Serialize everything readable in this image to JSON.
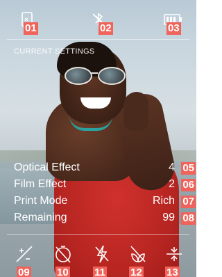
{
  "top_icons": [
    {
      "name": "phone-icon",
      "tag": "01"
    },
    {
      "name": "bluetooth-off-icon",
      "tag": "02"
    },
    {
      "name": "battery-icon",
      "tag": "03"
    }
  ],
  "settings": {
    "title": "CURRENT SETTINGS",
    "rows": [
      {
        "label": "Optical Effect",
        "value": "4",
        "tag": "05"
      },
      {
        "label": "Film Effect",
        "value": "2",
        "tag": "06"
      },
      {
        "label": "Print Mode",
        "value": "Rich",
        "tag": "07"
      },
      {
        "label": "Remaining",
        "value": "99",
        "tag": "08"
      }
    ]
  },
  "bottom_icons": [
    {
      "name": "exposure-compensation-icon",
      "tag": "09"
    },
    {
      "name": "self-timer-off-icon",
      "tag": "10"
    },
    {
      "name": "flash-off-icon",
      "tag": "11"
    },
    {
      "name": "macro-off-icon",
      "tag": "12"
    },
    {
      "name": "level-icon",
      "tag": "13"
    }
  ]
}
